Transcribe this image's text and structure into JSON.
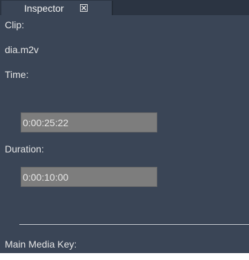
{
  "inspector": {
    "tab_label": "Inspector",
    "clip_label": "Clip:",
    "clip_value": "dia.m2v",
    "time_label": "Time:",
    "time_value": "0:00:25:22",
    "duration_label": "Duration:",
    "duration_value": "0:00:10:00",
    "media_key_label": "Main Media Key:"
  },
  "icons": {
    "tab_close": "close-box-icon"
  },
  "colors": {
    "panel_bg": "#3a4556",
    "tabbar_bg": "#2b3442",
    "field_bg": "#7d7d7d",
    "text": "#e6e6e6"
  }
}
